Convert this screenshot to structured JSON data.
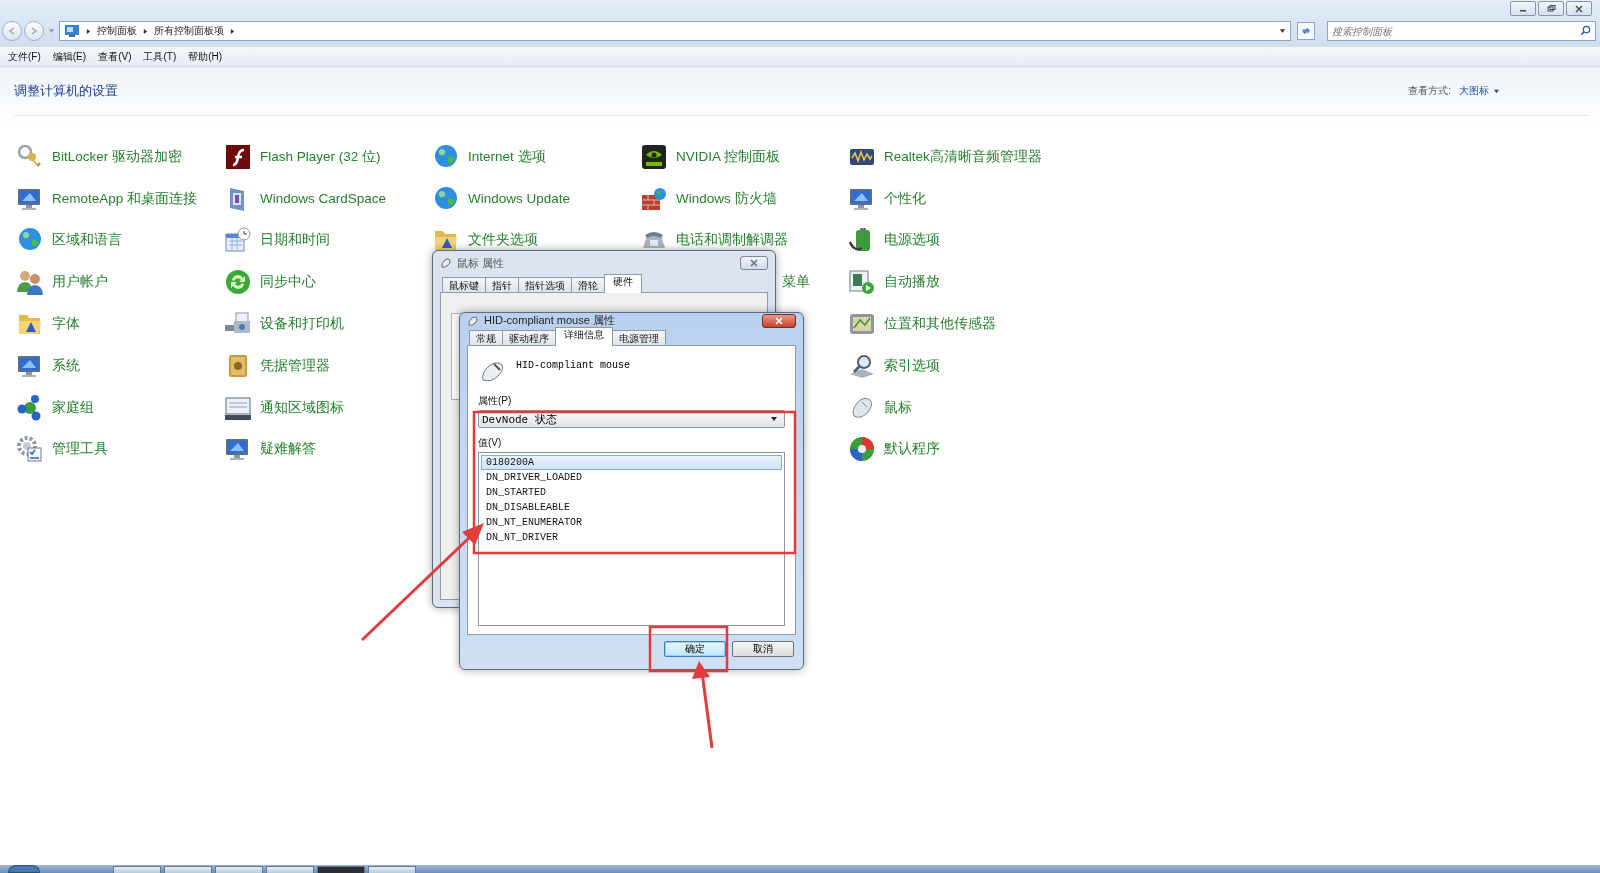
{
  "window": {
    "breadcrumbs": [
      "控制面板",
      "所有控制面板项"
    ],
    "search": {
      "placeholder": "搜索控制面板"
    },
    "menu": [
      "文件(F)",
      "编辑(E)",
      "查看(V)",
      "工具(T)",
      "帮助(H)"
    ]
  },
  "header": {
    "title": "调整计算机的设置",
    "view_label": "查看方式:",
    "view_value": "大图标"
  },
  "columns": [
    [
      {
        "label": "BitLocker 驱动器加密"
      },
      {
        "label": "RemoteApp 和桌面连接"
      },
      {
        "label": "区域和语言"
      },
      {
        "label": "用户帐户"
      },
      {
        "label": "字体"
      },
      {
        "label": "系统"
      },
      {
        "label": "家庭组"
      },
      {
        "label": "管理工具"
      }
    ],
    [
      {
        "label": "Flash Player (32 位)"
      },
      {
        "label": "Windows CardSpace"
      },
      {
        "label": "日期和时间"
      },
      {
        "label": "同步中心"
      },
      {
        "label": "设备和打印机"
      },
      {
        "label": "凭据管理器"
      },
      {
        "label": "通知区域图标"
      },
      {
        "label": "疑难解答"
      }
    ],
    [
      {
        "label": "Internet 选项"
      },
      {
        "label": "Windows Update"
      },
      {
        "label": "文件夹选项"
      }
    ],
    [
      {
        "label": "NVIDIA 控制面板"
      },
      {
        "label": "Windows 防火墙"
      },
      {
        "label": "电话和调制解调器"
      },
      {
        "label": "菜单",
        "kind": "cut"
      }
    ],
    [
      {
        "label": "Realtek高清晰音频管理器"
      },
      {
        "label": "个性化"
      },
      {
        "label": "电源选项"
      },
      {
        "label": "自动播放"
      },
      {
        "label": "位置和其他传感器"
      },
      {
        "label": "索引选项"
      },
      {
        "label": "鼠标"
      },
      {
        "label": "默认程序"
      }
    ]
  ],
  "dialogs": [
    {
      "title": "鼠标 属性",
      "active": false,
      "tabs": [
        {
          "label": "鼠标键",
          "selected": false
        },
        {
          "label": "指针",
          "selected": false
        },
        {
          "label": "指针选项",
          "selected": false
        },
        {
          "label": "滑轮",
          "selected": false
        },
        {
          "label": "硬件",
          "selected": true
        }
      ]
    },
    {
      "title": "HID-compliant mouse 属性",
      "active": true,
      "tabs": [
        {
          "label": "常规",
          "selected": false
        },
        {
          "label": "驱动程序",
          "selected": false
        },
        {
          "label": "详细信息",
          "selected": true
        },
        {
          "label": "电源管理",
          "selected": false
        }
      ],
      "device": "HID-compliant mouse",
      "property_label": "属性(P)",
      "property_value": "DevNode 状态",
      "value_label": "值(V)",
      "values": [
        {
          "text": "0180200A",
          "selected": true
        },
        {
          "text": "DN_DRIVER_LOADED",
          "selected": false
        },
        {
          "text": "DN_STARTED",
          "selected": false
        },
        {
          "text": "DN_DISABLEABLE",
          "selected": false
        },
        {
          "text": "DN_NT_ENUMERATOR",
          "selected": false
        },
        {
          "text": "DN_NT_DRIVER",
          "selected": false
        }
      ],
      "buttons": [
        {
          "label": "确定",
          "default": true
        },
        {
          "label": "取消",
          "default": false
        }
      ]
    }
  ]
}
